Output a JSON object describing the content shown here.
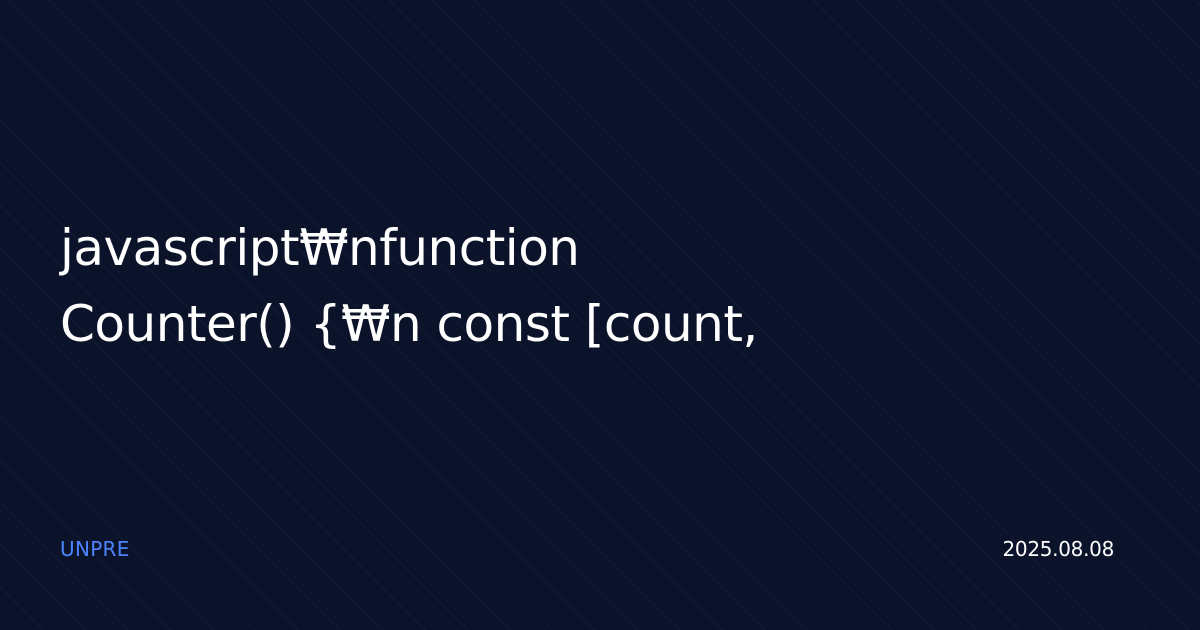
{
  "card": {
    "title_lines": [
      "javascript₩nfunction",
      "Counter() {₩n const [count,"
    ],
    "brand": "UNPRE",
    "date": "2025.08.08"
  },
  "colors": {
    "background": "#0b132b",
    "title": "#ffffff",
    "brand": "#4c84ff",
    "date": "#ffffff"
  }
}
